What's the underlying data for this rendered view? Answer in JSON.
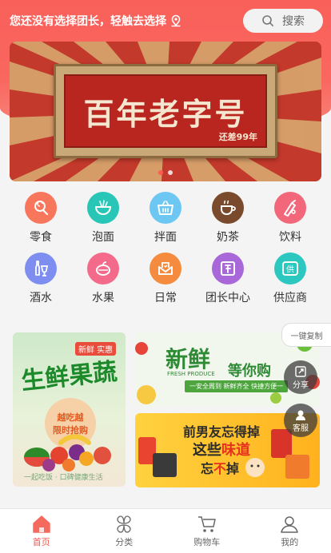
{
  "header": {
    "location_text": "您还没有选择团长，轻触去选择",
    "search_label": "搜索"
  },
  "banner": {
    "title": "百年老字号",
    "subtitle": "还差99年",
    "slide_count": 2,
    "active_slide": 1
  },
  "categories": [
    {
      "label": "零食",
      "icon": "lollipop-icon",
      "color": "#f8775c"
    },
    {
      "label": "泡面",
      "icon": "noodle-bowl-icon",
      "color": "#27c6b7"
    },
    {
      "label": "拌面",
      "icon": "basket-icon",
      "color": "#6dc7f3"
    },
    {
      "label": "奶茶",
      "icon": "milk-tea-cup-icon",
      "color": "#7a4a2c"
    },
    {
      "label": "饮料",
      "icon": "drink-icon",
      "color": "#f2677a"
    },
    {
      "label": "酒水",
      "icon": "wine-icon",
      "color": "#7d8ef0"
    },
    {
      "label": "水果",
      "icon": "fruit-icon",
      "color": "#f36a8a"
    },
    {
      "label": "日常",
      "icon": "daily-box-icon",
      "color": "#f58b3e"
    },
    {
      "label": "团长中心",
      "icon": "leader-center-icon",
      "color": "#a968d9"
    },
    {
      "label": "供应商",
      "icon": "supplier-icon",
      "color": "#2cc7be"
    }
  ],
  "promos": {
    "left": {
      "tag": "新鲜 实惠",
      "title": "生鲜果蔬",
      "sub1": "越吃越",
      "sub2": "限时抢购",
      "footer": "一起吃饭 · 口碑健康生活"
    },
    "right_top": {
      "title": "新鲜",
      "en": "FRESH PRODUCE",
      "slogan": "等你购",
      "bar": "一安全周到  新鲜齐全  快捷方便一"
    },
    "right_bottom": {
      "line1": "前男友忘得掉",
      "line2_pre": "这些",
      "line2_hl": "味道",
      "line3_pre": "忘",
      "line3_hl": "不",
      "line3_post": "掉"
    }
  },
  "floating": {
    "copy_label": "一键复制",
    "share_label": "分享",
    "service_label": "客服"
  },
  "tabbar": [
    {
      "label": "首页",
      "icon": "home-icon",
      "active": true
    },
    {
      "label": "分类",
      "icon": "category-grid-icon",
      "active": false
    },
    {
      "label": "购物车",
      "icon": "cart-icon",
      "active": false
    },
    {
      "label": "我的",
      "icon": "user-icon",
      "active": false
    }
  ],
  "colors": {
    "brand": "#f9605a",
    "active_tab": "#f05a50"
  }
}
